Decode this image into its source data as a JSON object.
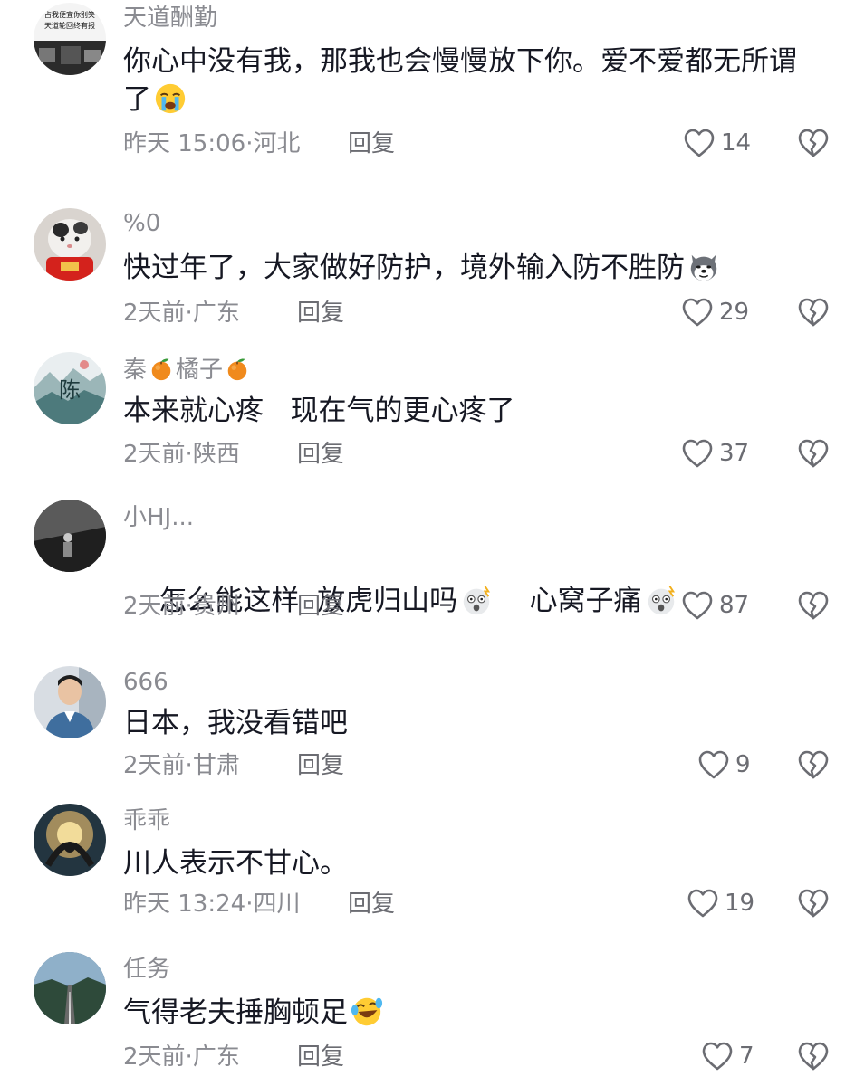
{
  "comments": [
    {
      "username": "天道酬勤",
      "avatar_caption_1": "占我便宜你别笑",
      "avatar_caption_2": "天道轮回终有报",
      "text_line1": "你心中没有我，那我也会慢慢放下你。爱不爱都无所谓",
      "text_line2": "了",
      "emoji": "loudly-crying-emoji",
      "time": "昨天 15:06",
      "location": "河北",
      "reply_label": "回复",
      "likes": "14"
    },
    {
      "username": "%0",
      "text": "快过年了，大家做好防护，境外输入防不胜防",
      "emoji": "husky-dog-emoji",
      "time": "2天前",
      "location": "广东",
      "reply_label": "回复",
      "likes": "29"
    },
    {
      "username_a": "秦",
      "username_b": "橘子",
      "name_emoji": "tangerine-emoji",
      "text": "本来就心疼   现在气的更心疼了",
      "time": "2天前",
      "location": "陕西",
      "reply_label": "回复",
      "likes": "37"
    },
    {
      "username": "小HJ...",
      "text_a": "怎么能这样  放虎归山吗",
      "text_b": "心窝子痛",
      "emoji": "shocked-face-emoji",
      "time": "2天前",
      "location": "贵州",
      "reply_label": "回复",
      "likes": "87"
    },
    {
      "username": "666",
      "text": "日本，我没看错吧",
      "time": "2天前",
      "location": "甘肃",
      "reply_label": "回复",
      "likes": "9"
    },
    {
      "username": "乖乖",
      "text": "川人表示不甘心。",
      "time": "昨天 13:24",
      "location": "四川",
      "reply_label": "回复",
      "likes": "19"
    },
    {
      "username": "任务",
      "text": "气得老夫捶胸顿足",
      "emoji": "laughing-tears-emoji",
      "time": "2天前",
      "location": "广东",
      "reply_label": "回复",
      "likes": "7"
    }
  ],
  "separator": "·",
  "colors": {
    "primary_text": "#161823",
    "secondary_text": "#8a8b91",
    "icon_gray": "#6b6c72",
    "background": "#ffffff"
  },
  "icons": {
    "like": "heart-outline-icon",
    "dislike": "broken-heart-icon"
  }
}
